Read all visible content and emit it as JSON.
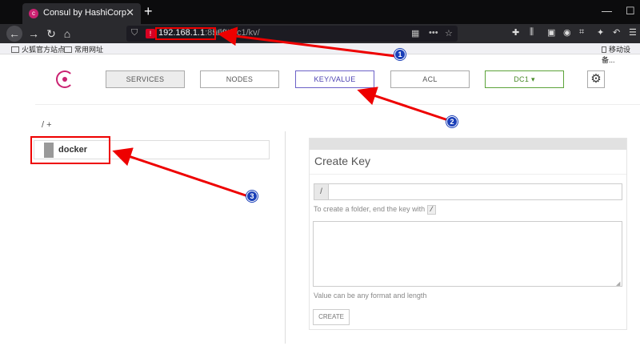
{
  "browser": {
    "tab_title": "Consul by HashiCorp",
    "tab_close": "✕",
    "new_tab": "+",
    "url_host": "192.168.1.1",
    "url_port": ":8500",
    "url_path": "/ui/#/dc1/kv/",
    "bookmarks": [
      "火狐官方站点",
      "常用网址"
    ],
    "mobile_bookmarks": "移动设备..."
  },
  "nav": {
    "services": "SERVICES",
    "nodes": "NODES",
    "kv": "KEY/VALUE",
    "acl": "ACL",
    "dc": "DC1 ▾"
  },
  "kv": {
    "breadcrumb": "/ +",
    "items": [
      {
        "label": "docker"
      }
    ]
  },
  "create_panel": {
    "title": "Create Key",
    "prefix": "/",
    "folder_hint_prefix": "To create a folder, end the key with",
    "folder_hint_code": "/",
    "value_hint": "Value can be any format and length",
    "create_button": "CREATE"
  },
  "annotations": [
    "1",
    "2",
    "3"
  ],
  "colors": {
    "consul_brand": "#ca2171",
    "annotation_red": "#e00000",
    "annotation_badge": "#1a3fb8",
    "kv_accent": "#6c61c7",
    "dc_accent": "#5ca33a"
  }
}
